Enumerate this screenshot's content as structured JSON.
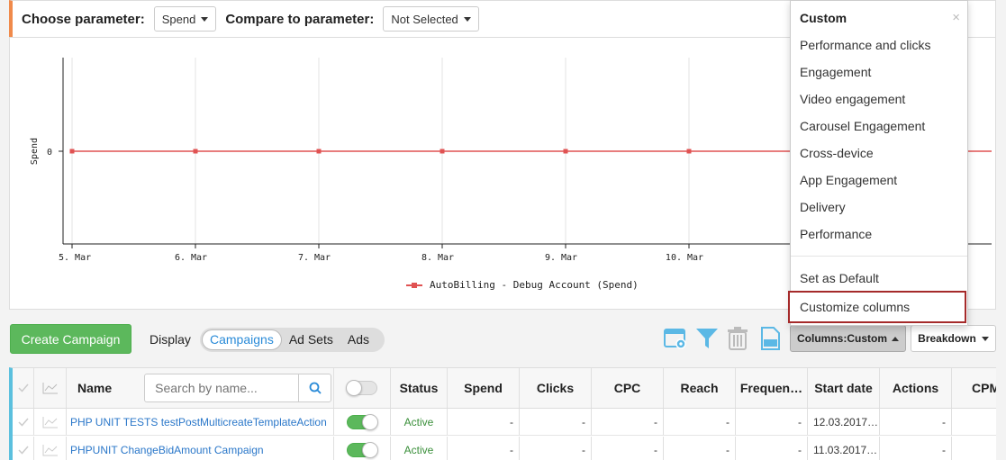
{
  "params": {
    "choose_label": "Choose parameter:",
    "choose_value": "Spend",
    "compare_label": "Compare to parameter:",
    "compare_value": "Not Selected"
  },
  "chart_data": {
    "type": "line",
    "ylabel": "Spend",
    "y_ticks": [
      "0"
    ],
    "categories": [
      "5. Mar",
      "6. Mar",
      "7. Mar",
      "8. Mar",
      "9. Mar",
      "10. Mar"
    ],
    "series": [
      {
        "name": "AutoBilling - Debug Account (Spend)",
        "values": [
          0,
          0,
          0,
          0,
          0,
          0,
          0
        ],
        "color": "#e05252"
      }
    ]
  },
  "toolbar": {
    "create_label": "Create Campaign",
    "display_label": "Display",
    "segments": [
      "Campaigns",
      "Ad Sets",
      "Ads"
    ],
    "columns_prefix": "Columns:",
    "columns_value": "Custom",
    "breakdown_label": "Breakdown"
  },
  "table": {
    "headers": {
      "name": "Name",
      "status": "Status",
      "spend": "Spend",
      "clicks": "Clicks",
      "cpc": "CPC",
      "reach": "Reach",
      "frequency": "Frequen…",
      "start": "Start date",
      "actions": "Actions",
      "cpm": "CPM"
    },
    "search_placeholder": "Search by name...",
    "rows": [
      {
        "name": "PHP UNIT TESTS testPostMulticreateTemplateAction",
        "status": "Active",
        "spend": "-",
        "clicks": "-",
        "cpc": "-",
        "reach": "-",
        "frequency": "-",
        "start": "12.03.2017…",
        "actions": "-"
      },
      {
        "name": "PHPUNIT ChangeBidAmount Campaign",
        "status": "Active",
        "spend": "-",
        "clicks": "-",
        "cpc": "-",
        "reach": "-",
        "frequency": "-",
        "start": "11.03.2017…",
        "actions": "-"
      }
    ]
  },
  "menu": {
    "header": "Custom",
    "close": "×",
    "items": [
      "Performance and clicks",
      "Engagement",
      "Video engagement",
      "Carousel Engagement",
      "Cross-device",
      "App Engagement",
      "Delivery",
      "Performance"
    ],
    "set_default": "Set as Default",
    "customize": "Customize columns"
  },
  "colors": {
    "accent": "#2a8bd8",
    "primary_green": "#5cb85c",
    "line_red": "#e05252",
    "highlight_border": "#a52a2a"
  }
}
